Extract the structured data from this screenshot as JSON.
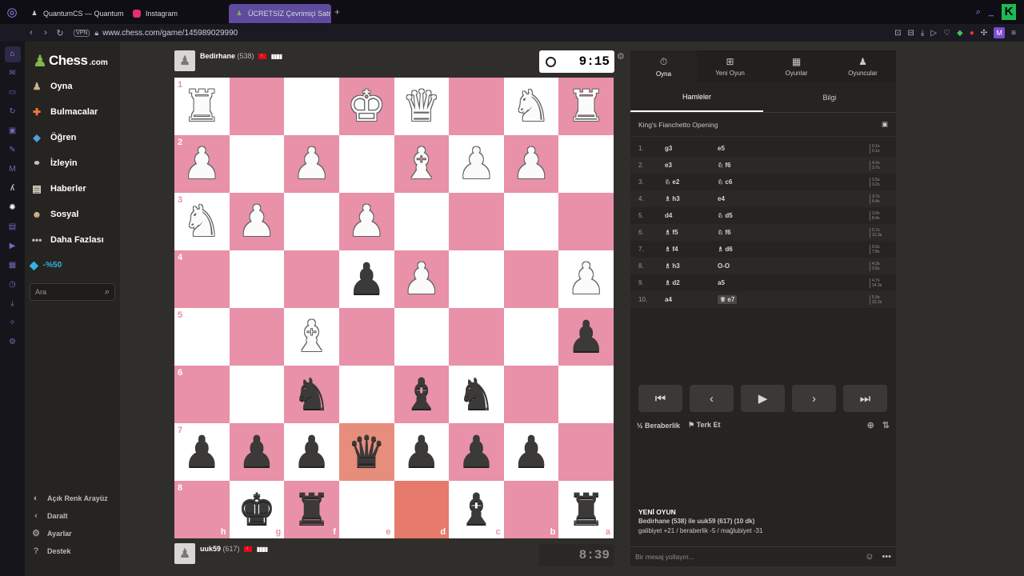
{
  "browser": {
    "tabs": [
      {
        "label": "QuantumCS — Quantum",
        "icon": "quantum-favicon",
        "active": false
      },
      {
        "label": "Instagram",
        "icon": "instagram-favicon",
        "active": false
      },
      {
        "label": "ÜCRETSİZ Çevrimiçi Satra",
        "icon": "chess-favicon",
        "active": true
      }
    ],
    "url": "www.chess.com/game/145989029990",
    "vpn_label": "VPN"
  },
  "sidebar": {
    "brand": "Chess",
    "brand_suffix": ".com",
    "items": [
      {
        "label": "Oyna",
        "icon": "play-icon"
      },
      {
        "label": "Bulmacalar",
        "icon": "puzzle-icon"
      },
      {
        "label": "Öğren",
        "icon": "learn-icon"
      },
      {
        "label": "İzleyin",
        "icon": "binoculars-icon"
      },
      {
        "label": "Haberler",
        "icon": "news-icon"
      },
      {
        "label": "Sosyal",
        "icon": "social-icon"
      },
      {
        "label": "Daha Fazlası",
        "icon": "more-icon"
      }
    ],
    "premium": "-%50",
    "search_placeholder": "Ara",
    "bottom": [
      {
        "label": "Açık Renk Arayüz",
        "icon": "contrast-icon"
      },
      {
        "label": "Daralt",
        "icon": "collapse-icon"
      },
      {
        "label": "Ayarlar",
        "icon": "gear-icon"
      },
      {
        "label": "Destek",
        "icon": "help-icon"
      }
    ]
  },
  "top_player": {
    "name": "Bedirhane",
    "rating": "(538)",
    "clock": "9:15"
  },
  "bottom_player": {
    "name": "uuk59",
    "rating": "(617)",
    "clock": "8:39"
  },
  "board": {
    "ranks": [
      "1",
      "2",
      "3",
      "4",
      "5",
      "6",
      "7",
      "8"
    ],
    "files": [
      "h",
      "g",
      "f",
      "e",
      "d",
      "c",
      "b",
      "a"
    ],
    "rows": [
      [
        "wR",
        "",
        "",
        "wK",
        "wQ",
        "",
        "wN",
        "wR"
      ],
      [
        "wP",
        "",
        "wP",
        "",
        "wB",
        "wP",
        "wP",
        ""
      ],
      [
        "wN",
        "wP",
        "",
        "wP",
        "",
        "",
        "",
        ""
      ],
      [
        "",
        "",
        "",
        "bP",
        "wP",
        "",
        "",
        "wP"
      ],
      [
        "",
        "",
        "wB",
        "",
        "",
        "",
        "",
        "bP"
      ],
      [
        "",
        "",
        "bN",
        "",
        "bB",
        "bN",
        "",
        ""
      ],
      [
        "bP",
        "bP",
        "bP",
        "bQ",
        "bP",
        "bP",
        "bP",
        ""
      ],
      [
        "",
        "bK",
        "bR",
        "",
        "",
        "bB",
        "",
        "bR"
      ]
    ],
    "highlights": [
      "6-3",
      "7-4"
    ]
  },
  "panel": {
    "tabs": [
      {
        "label": "Oyna",
        "icon": "stopwatch-icon"
      },
      {
        "label": "Yeni Oyun",
        "icon": "plus-icon"
      },
      {
        "label": "Oyunlar",
        "icon": "board-icon"
      },
      {
        "label": "Oyuncular",
        "icon": "players-icon"
      }
    ],
    "subtabs": [
      "Hamleler",
      "Bilgi"
    ],
    "opening": "King's Fianchetto Opening",
    "moves": [
      {
        "n": "1.",
        "w": "g3",
        "b": "e5",
        "wp": "",
        "bp": "",
        "t1": "0.1s",
        "t2": "0.1s"
      },
      {
        "n": "2.",
        "w": "e3",
        "b": "f6",
        "wp": "",
        "bp": "♘",
        "t1": "4.2s",
        "t2": "3.7s"
      },
      {
        "n": "3.",
        "w": "e2",
        "b": "c6",
        "wp": "♘",
        "bp": "♘",
        "t1": "2.5s",
        "t2": "3.2s"
      },
      {
        "n": "4.",
        "w": "h3",
        "b": "e4",
        "wp": "♗",
        "bp": "",
        "t1": "3.7s",
        "t2": "6.4s"
      },
      {
        "n": "5.",
        "w": "d4",
        "b": "d5",
        "wp": "",
        "bp": "♘",
        "t1": "3.0s",
        "t2": "8.4s"
      },
      {
        "n": "6.",
        "w": "f5",
        "b": "f6",
        "wp": "♗",
        "bp": "♘",
        "t1": "5.7s",
        "t2": "12.3s"
      },
      {
        "n": "7.",
        "w": "f4",
        "b": "d6",
        "wp": "♗",
        "bp": "♗",
        "t1": "6.5s",
        "t2": "7.8s"
      },
      {
        "n": "8.",
        "w": "h3",
        "b": "O-O",
        "wp": "♗",
        "bp": "",
        "t1": "4.3s",
        "t2": "2.6s"
      },
      {
        "n": "9.",
        "w": "d2",
        "b": "a5",
        "wp": "♗",
        "bp": "",
        "t1": "4.7s",
        "t2": "14.3s"
      },
      {
        "n": "10.",
        "w": "a4",
        "b": "e7",
        "wp": "",
        "bp": "♕",
        "t1": "5.9s",
        "t2": "22.2s"
      }
    ],
    "draw_label": "Beraberlik",
    "draw_prefix": "½",
    "resign_label": "Terk Et",
    "new_game": {
      "title": "YENİ OYUN",
      "line1": "Bedirhane (538) ile uuk59 (617) (10 dk)",
      "line2": "galibiyet +21 / beraberlik -5 / mağlubiyet -31"
    },
    "chat_placeholder": "Bir mesaj yollayın..."
  }
}
